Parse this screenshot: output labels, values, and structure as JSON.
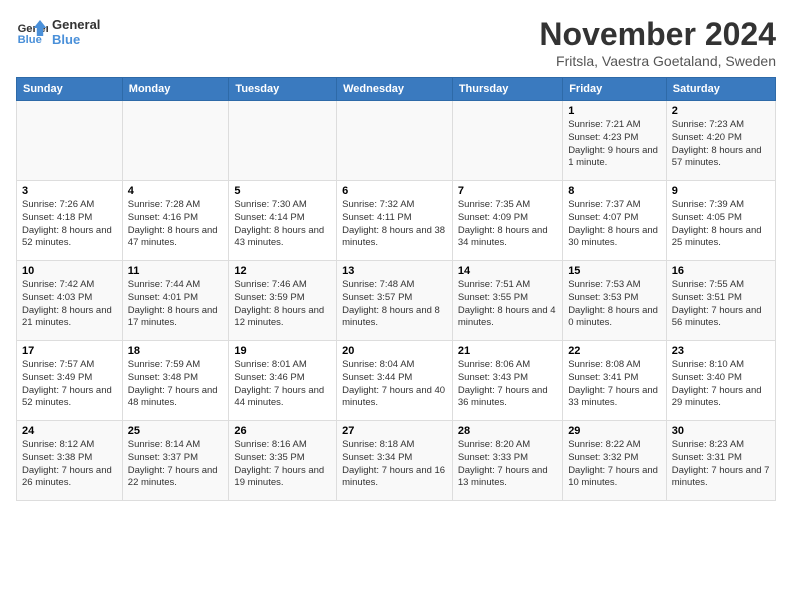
{
  "logo": {
    "text_general": "General",
    "text_blue": "Blue"
  },
  "header": {
    "month": "November 2024",
    "location": "Fritsla, Vaestra Goetaland, Sweden"
  },
  "weekdays": [
    "Sunday",
    "Monday",
    "Tuesday",
    "Wednesday",
    "Thursday",
    "Friday",
    "Saturday"
  ],
  "weeks": [
    [
      {
        "day": "",
        "sunrise": "",
        "sunset": "",
        "daylight": ""
      },
      {
        "day": "",
        "sunrise": "",
        "sunset": "",
        "daylight": ""
      },
      {
        "day": "",
        "sunrise": "",
        "sunset": "",
        "daylight": ""
      },
      {
        "day": "",
        "sunrise": "",
        "sunset": "",
        "daylight": ""
      },
      {
        "day": "",
        "sunrise": "",
        "sunset": "",
        "daylight": ""
      },
      {
        "day": "1",
        "sunrise": "Sunrise: 7:21 AM",
        "sunset": "Sunset: 4:23 PM",
        "daylight": "Daylight: 9 hours and 1 minute."
      },
      {
        "day": "2",
        "sunrise": "Sunrise: 7:23 AM",
        "sunset": "Sunset: 4:20 PM",
        "daylight": "Daylight: 8 hours and 57 minutes."
      }
    ],
    [
      {
        "day": "3",
        "sunrise": "Sunrise: 7:26 AM",
        "sunset": "Sunset: 4:18 PM",
        "daylight": "Daylight: 8 hours and 52 minutes."
      },
      {
        "day": "4",
        "sunrise": "Sunrise: 7:28 AM",
        "sunset": "Sunset: 4:16 PM",
        "daylight": "Daylight: 8 hours and 47 minutes."
      },
      {
        "day": "5",
        "sunrise": "Sunrise: 7:30 AM",
        "sunset": "Sunset: 4:14 PM",
        "daylight": "Daylight: 8 hours and 43 minutes."
      },
      {
        "day": "6",
        "sunrise": "Sunrise: 7:32 AM",
        "sunset": "Sunset: 4:11 PM",
        "daylight": "Daylight: 8 hours and 38 minutes."
      },
      {
        "day": "7",
        "sunrise": "Sunrise: 7:35 AM",
        "sunset": "Sunset: 4:09 PM",
        "daylight": "Daylight: 8 hours and 34 minutes."
      },
      {
        "day": "8",
        "sunrise": "Sunrise: 7:37 AM",
        "sunset": "Sunset: 4:07 PM",
        "daylight": "Daylight: 8 hours and 30 minutes."
      },
      {
        "day": "9",
        "sunrise": "Sunrise: 7:39 AM",
        "sunset": "Sunset: 4:05 PM",
        "daylight": "Daylight: 8 hours and 25 minutes."
      }
    ],
    [
      {
        "day": "10",
        "sunrise": "Sunrise: 7:42 AM",
        "sunset": "Sunset: 4:03 PM",
        "daylight": "Daylight: 8 hours and 21 minutes."
      },
      {
        "day": "11",
        "sunrise": "Sunrise: 7:44 AM",
        "sunset": "Sunset: 4:01 PM",
        "daylight": "Daylight: 8 hours and 17 minutes."
      },
      {
        "day": "12",
        "sunrise": "Sunrise: 7:46 AM",
        "sunset": "Sunset: 3:59 PM",
        "daylight": "Daylight: 8 hours and 12 minutes."
      },
      {
        "day": "13",
        "sunrise": "Sunrise: 7:48 AM",
        "sunset": "Sunset: 3:57 PM",
        "daylight": "Daylight: 8 hours and 8 minutes."
      },
      {
        "day": "14",
        "sunrise": "Sunrise: 7:51 AM",
        "sunset": "Sunset: 3:55 PM",
        "daylight": "Daylight: 8 hours and 4 minutes."
      },
      {
        "day": "15",
        "sunrise": "Sunrise: 7:53 AM",
        "sunset": "Sunset: 3:53 PM",
        "daylight": "Daylight: 8 hours and 0 minutes."
      },
      {
        "day": "16",
        "sunrise": "Sunrise: 7:55 AM",
        "sunset": "Sunset: 3:51 PM",
        "daylight": "Daylight: 7 hours and 56 minutes."
      }
    ],
    [
      {
        "day": "17",
        "sunrise": "Sunrise: 7:57 AM",
        "sunset": "Sunset: 3:49 PM",
        "daylight": "Daylight: 7 hours and 52 minutes."
      },
      {
        "day": "18",
        "sunrise": "Sunrise: 7:59 AM",
        "sunset": "Sunset: 3:48 PM",
        "daylight": "Daylight: 7 hours and 48 minutes."
      },
      {
        "day": "19",
        "sunrise": "Sunrise: 8:01 AM",
        "sunset": "Sunset: 3:46 PM",
        "daylight": "Daylight: 7 hours and 44 minutes."
      },
      {
        "day": "20",
        "sunrise": "Sunrise: 8:04 AM",
        "sunset": "Sunset: 3:44 PM",
        "daylight": "Daylight: 7 hours and 40 minutes."
      },
      {
        "day": "21",
        "sunrise": "Sunrise: 8:06 AM",
        "sunset": "Sunset: 3:43 PM",
        "daylight": "Daylight: 7 hours and 36 minutes."
      },
      {
        "day": "22",
        "sunrise": "Sunrise: 8:08 AM",
        "sunset": "Sunset: 3:41 PM",
        "daylight": "Daylight: 7 hours and 33 minutes."
      },
      {
        "day": "23",
        "sunrise": "Sunrise: 8:10 AM",
        "sunset": "Sunset: 3:40 PM",
        "daylight": "Daylight: 7 hours and 29 minutes."
      }
    ],
    [
      {
        "day": "24",
        "sunrise": "Sunrise: 8:12 AM",
        "sunset": "Sunset: 3:38 PM",
        "daylight": "Daylight: 7 hours and 26 minutes."
      },
      {
        "day": "25",
        "sunrise": "Sunrise: 8:14 AM",
        "sunset": "Sunset: 3:37 PM",
        "daylight": "Daylight: 7 hours and 22 minutes."
      },
      {
        "day": "26",
        "sunrise": "Sunrise: 8:16 AM",
        "sunset": "Sunset: 3:35 PM",
        "daylight": "Daylight: 7 hours and 19 minutes."
      },
      {
        "day": "27",
        "sunrise": "Sunrise: 8:18 AM",
        "sunset": "Sunset: 3:34 PM",
        "daylight": "Daylight: 7 hours and 16 minutes."
      },
      {
        "day": "28",
        "sunrise": "Sunrise: 8:20 AM",
        "sunset": "Sunset: 3:33 PM",
        "daylight": "Daylight: 7 hours and 13 minutes."
      },
      {
        "day": "29",
        "sunrise": "Sunrise: 8:22 AM",
        "sunset": "Sunset: 3:32 PM",
        "daylight": "Daylight: 7 hours and 10 minutes."
      },
      {
        "day": "30",
        "sunrise": "Sunrise: 8:23 AM",
        "sunset": "Sunset: 3:31 PM",
        "daylight": "Daylight: 7 hours and 7 minutes."
      }
    ]
  ]
}
